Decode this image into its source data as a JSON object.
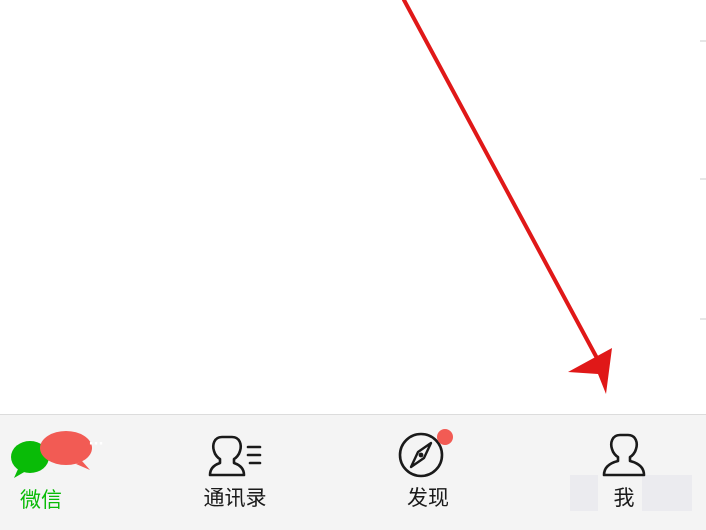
{
  "tab_bar": {
    "tabs": [
      {
        "id": "chats",
        "label": "微信",
        "icon": "chat-bubbles-icon",
        "active": true,
        "unread_badge": "···"
      },
      {
        "id": "contacts",
        "label": "通讯录",
        "icon": "contacts-icon",
        "active": false
      },
      {
        "id": "discover",
        "label": "发现",
        "icon": "compass-icon",
        "active": false,
        "dot_badge": true
      },
      {
        "id": "me",
        "label": "我",
        "icon": "person-icon",
        "active": false
      }
    ]
  },
  "annotation": {
    "icon": "red-arrow-annotation",
    "color": "#e01818",
    "points_to": "me"
  },
  "colors": {
    "active_green": "#09bb07",
    "badge_red": "#f25b54",
    "tab_bar_bg": "#f4f4f4",
    "icon_stroke": "#1a1a1a"
  }
}
